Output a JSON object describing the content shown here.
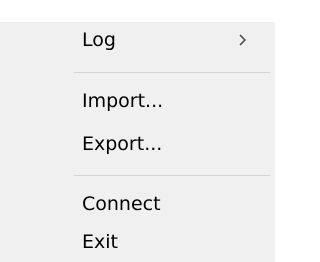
{
  "menu": {
    "items": [
      {
        "label": "Log",
        "has_submenu": true,
        "submenu_icon": "chevron-right-icon"
      },
      {
        "label": "Import..."
      },
      {
        "label": "Export..."
      },
      {
        "label": "Connect"
      },
      {
        "label": "Exit"
      }
    ]
  },
  "colors": {
    "menu_background": "#f0f0f0",
    "separator": "#d4d4d4",
    "text": "#000000"
  }
}
